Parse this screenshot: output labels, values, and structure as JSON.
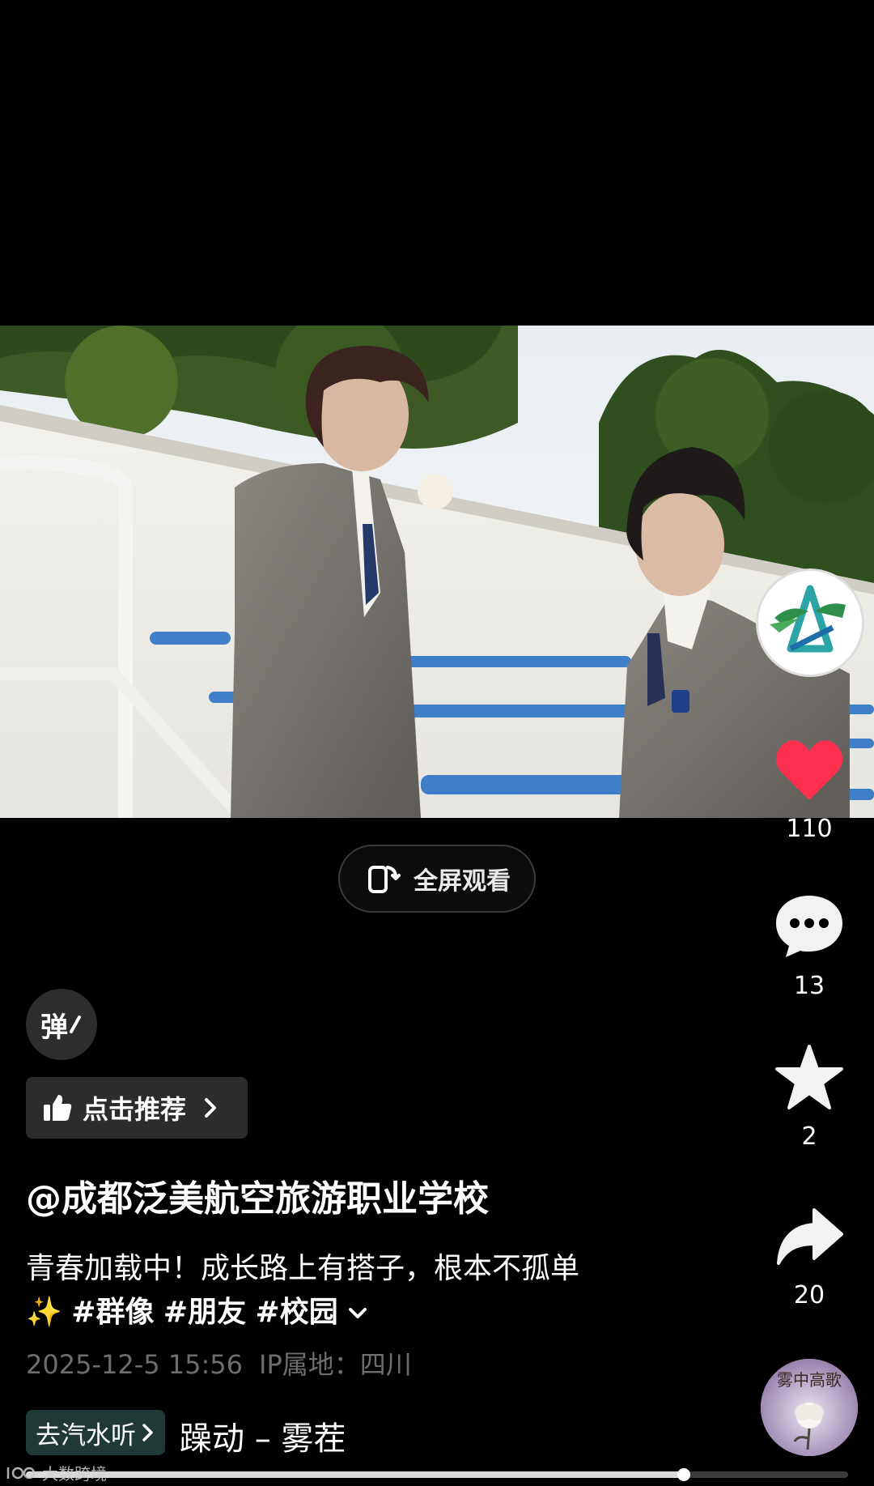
{
  "video": {
    "fullscreen_label": "全屏观看",
    "progress_fraction": 0.8
  },
  "actions": {
    "like_count": "110",
    "comment_count": "13",
    "favorite_count": "2",
    "share_count": "20"
  },
  "overlay": {
    "danmu_label": "弹",
    "recommend_label": "点击推荐"
  },
  "post": {
    "author": "@成都泛美航空旅游职业学校",
    "caption_line1": "青春加载中！成长路上有搭子，根本不孤单",
    "caption_emoji": "✨",
    "tags": [
      "#群像",
      "#朋友",
      "#校园"
    ],
    "date": "2025-12-5 15:56",
    "ip_location": "IP属地：四川"
  },
  "music": {
    "pill_label": "去汽水听",
    "title": "躁动 – 雾茬",
    "disc_text": "雾中高歌"
  },
  "watermark": {
    "text": "大数跨境"
  },
  "colors": {
    "like_red": "#ff2f4f",
    "pill_green": "#1f3a36",
    "meta_gray": "#6d6d6d"
  }
}
